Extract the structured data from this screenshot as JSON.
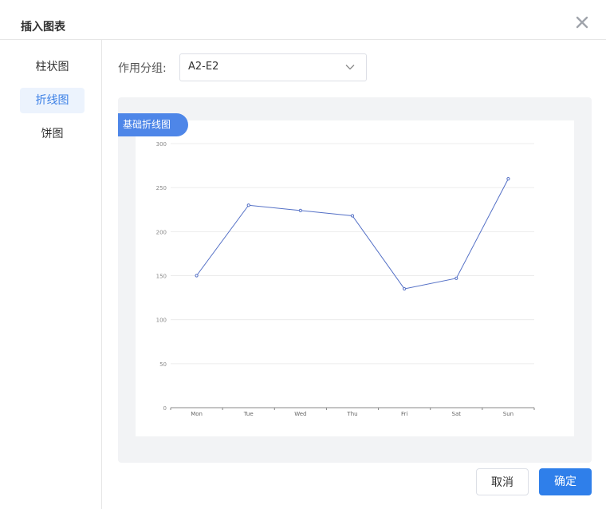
{
  "dialog": {
    "title": "插入图表"
  },
  "sidebar": {
    "items": [
      {
        "label": "柱状图",
        "active": false
      },
      {
        "label": "折线图",
        "active": true
      },
      {
        "label": "饼图",
        "active": false
      }
    ]
  },
  "group": {
    "label": "作用分组:",
    "value": "A2-E2"
  },
  "preview": {
    "badge": "基础折线图"
  },
  "buttons": {
    "cancel": "取消",
    "ok": "确定"
  },
  "colors": {
    "accent": "#2f7fea",
    "line": "#5470c6",
    "badge": "#4e86e8"
  },
  "chart_data": {
    "type": "line",
    "categories": [
      "Mon",
      "Tue",
      "Wed",
      "Thu",
      "Fri",
      "Sat",
      "Sun"
    ],
    "values": [
      150,
      230,
      224,
      218,
      135,
      147,
      260
    ],
    "ylim": [
      0,
      300
    ],
    "yticks": [
      0,
      50,
      100,
      150,
      200,
      250,
      300
    ],
    "grid": true
  }
}
